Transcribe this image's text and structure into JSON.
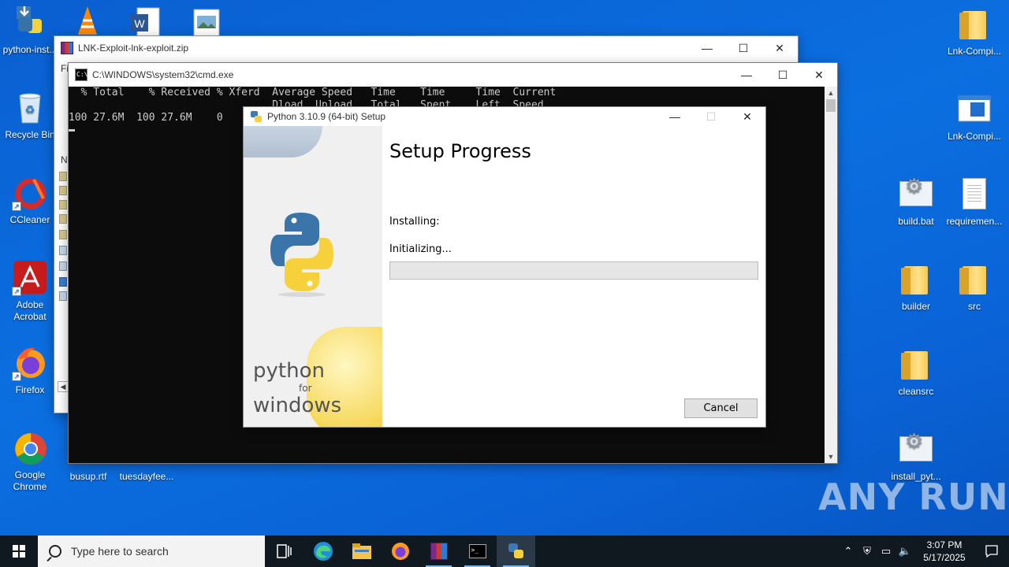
{
  "desktop": {
    "left_icons": [
      {
        "label": "python-inst...",
        "icon": "python-installer-icon"
      },
      {
        "label": "Recycle Bin",
        "icon": "recycle-bin-icon"
      },
      {
        "label": "CCleaner",
        "icon": "ccleaner-icon"
      },
      {
        "label": "Adobe Acrobat",
        "icon": "adobe-acrobat-icon"
      },
      {
        "label": "Firefox",
        "icon": "firefox-icon"
      },
      {
        "label": "Google Chrome",
        "icon": "chrome-icon"
      }
    ],
    "bottom_icons": [
      {
        "label": "busup.rtf",
        "icon": "rtf-file-icon"
      },
      {
        "label": "tuesdayfee...",
        "icon": "file-icon"
      }
    ],
    "right_icons": [
      {
        "label": "Lnk-Compi...",
        "icon": "folder-icon"
      },
      {
        "label": "Lnk-Compi...",
        "icon": "exe-window-icon"
      },
      {
        "label": "build.bat",
        "icon": "batch-file-icon"
      },
      {
        "label": "requiremen...",
        "icon": "text-file-icon"
      },
      {
        "label": "builder",
        "icon": "folder-icon"
      },
      {
        "label": "src",
        "icon": "folder-icon"
      },
      {
        "label": "cleansrc",
        "icon": "folder-icon"
      },
      {
        "label": "install_pyt...",
        "icon": "batch-file-icon"
      }
    ]
  },
  "winrar_window": {
    "title": "LNK-Exploit-lnk-exploit.zip",
    "menu_stub": "Fi",
    "column_stub": "N"
  },
  "cmd_window": {
    "title": "C:\\WINDOWS\\system32\\cmd.exe",
    "lines": [
      "  % Total    % Received % Xferd  Average Speed   Time    Time     Time  Current",
      "                                 Dload  Upload   Total   Spent    Left  Speed",
      "100 27.6M  100 27.6M    0"
    ]
  },
  "setup_window": {
    "title": "Python 3.10.9 (64-bit) Setup",
    "heading": "Setup Progress",
    "status_label": "Installing:",
    "status_detail": "Initializing...",
    "progress_percent": 0,
    "cancel_label": "Cancel",
    "brand_line1": "python",
    "brand_line2": "for",
    "brand_line3": "windows"
  },
  "taskbar": {
    "search_placeholder": "Type here to search",
    "apps": [
      "task-view-icon",
      "edge-icon",
      "file-explorer-icon",
      "firefox-icon",
      "winrar-icon",
      "cmd-icon",
      "python-installer-icon"
    ],
    "time": "3:07 PM",
    "date": "5/17/2025"
  },
  "watermark": "ANY RUN",
  "colors": {
    "desktop_blue": "#0b6fe0",
    "taskbar": "#101820",
    "progress_fill": "#06b025"
  }
}
